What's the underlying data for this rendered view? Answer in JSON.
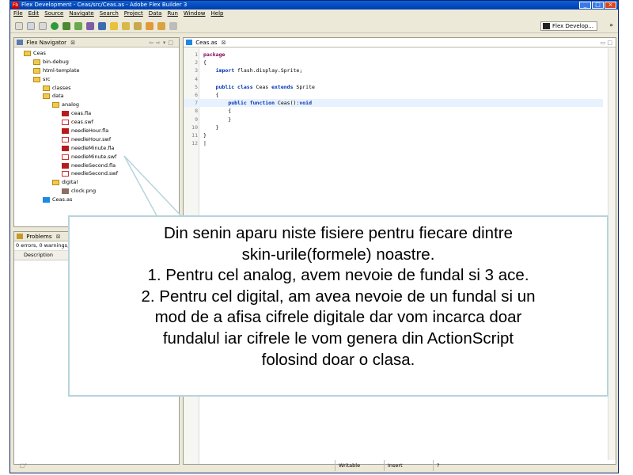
{
  "window": {
    "title": "Flex Development - Ceas/src/Ceas.as - Adobe Flex Builder 3",
    "app_icon": "Fb",
    "controls": [
      "minimize",
      "maximize",
      "close"
    ]
  },
  "menu": [
    "File",
    "Edit",
    "Source",
    "Navigate",
    "Search",
    "Project",
    "Data",
    "Run",
    "Window",
    "Help"
  ],
  "toolbar": {
    "perspective": "Flex Develop...",
    "overflow": "»"
  },
  "navigator": {
    "tab": "Flex Navigator",
    "tree": [
      {
        "label": "Ceas",
        "icon": "project-icon",
        "depth": 0
      },
      {
        "label": "bin-debug",
        "icon": "folder-icon",
        "depth": 1
      },
      {
        "label": "html-template",
        "icon": "folder-icon",
        "depth": 1
      },
      {
        "label": "src",
        "icon": "folder-icon",
        "depth": 1
      },
      {
        "label": "classes",
        "icon": "folder-icon",
        "depth": 2
      },
      {
        "label": "data",
        "icon": "folder-icon",
        "depth": 2
      },
      {
        "label": "analog",
        "icon": "folder-icon",
        "depth": 3
      },
      {
        "label": "ceas.fla",
        "icon": "fla-file-icon",
        "depth": 4
      },
      {
        "label": "ceas.swf",
        "icon": "swf-file-icon",
        "depth": 4
      },
      {
        "label": "needleHour.fla",
        "icon": "fla-file-icon",
        "depth": 4
      },
      {
        "label": "needleHour.swf",
        "icon": "swf-file-icon",
        "depth": 4
      },
      {
        "label": "needleMinute.fla",
        "icon": "fla-file-icon",
        "depth": 4
      },
      {
        "label": "needleMinute.swf",
        "icon": "swf-file-icon",
        "depth": 4
      },
      {
        "label": "needleSecond.fla",
        "icon": "fla-file-icon",
        "depth": 4
      },
      {
        "label": "needleSecond.swf",
        "icon": "swf-file-icon",
        "depth": 4
      },
      {
        "label": "digital",
        "icon": "folder-icon",
        "depth": 3
      },
      {
        "label": "clock.png",
        "icon": "image-file-icon",
        "depth": 4
      },
      {
        "label": "Ceas.as",
        "icon": "as-file-icon",
        "depth": 2
      }
    ]
  },
  "problems": {
    "tab": "Problems",
    "summary": "0 errors, 0 warnings, 0",
    "column": "Description"
  },
  "editor": {
    "tab": "Ceas.as",
    "lines": [
      {
        "n": "1",
        "parts": [
          {
            "t": "package",
            "c": "kw"
          }
        ]
      },
      {
        "n": "2",
        "parts": [
          {
            "t": "{",
            "c": ""
          }
        ]
      },
      {
        "n": "3",
        "parts": [
          {
            "t": "    ",
            "c": ""
          },
          {
            "t": "import",
            "c": "kw2"
          },
          {
            "t": " flash.display.Sprite;",
            "c": ""
          }
        ]
      },
      {
        "n": "4",
        "parts": []
      },
      {
        "n": "5",
        "parts": [
          {
            "t": "    ",
            "c": ""
          },
          {
            "t": "public class",
            "c": "kw2"
          },
          {
            "t": " Ceas ",
            "c": ""
          },
          {
            "t": "extends",
            "c": "kw2"
          },
          {
            "t": " Sprite",
            "c": ""
          }
        ]
      },
      {
        "n": "6",
        "parts": [
          {
            "t": "    {",
            "c": ""
          }
        ]
      },
      {
        "n": "7",
        "parts": [
          {
            "t": "        ",
            "c": ""
          },
          {
            "t": "public function",
            "c": "kw2"
          },
          {
            "t": " Ceas():",
            "c": ""
          },
          {
            "t": "void",
            "c": "kw2"
          }
        ]
      },
      {
        "n": "8",
        "parts": [
          {
            "t": "        {",
            "c": ""
          }
        ]
      },
      {
        "n": "9",
        "parts": [
          {
            "t": "        }",
            "c": ""
          }
        ]
      },
      {
        "n": "10",
        "parts": [
          {
            "t": "    }",
            "c": ""
          }
        ]
      },
      {
        "n": "11",
        "parts": [
          {
            "t": "}",
            "c": ""
          }
        ]
      },
      {
        "n": "12",
        "parts": [
          {
            "t": "|",
            "c": ""
          }
        ]
      }
    ]
  },
  "statusbar": {
    "mode": "Writable",
    "insert": "Insert",
    "position": "?"
  },
  "callout": {
    "lines": [
      "Din senin aparu niste fisiere pentru fiecare dintre",
      "skin-urile(formele) noastre.",
      "1. Pentru cel analog, avem nevoie de fundal si 3 ace.",
      "2. Pentru cel digital, am avea nevoie de un fundal si un",
      "mod de a afisa cifrele digitale dar vom incarca doar",
      "fundalul iar cifrele le vom genera din ActionScript",
      "folosind doar o clasa."
    ]
  },
  "colors": {
    "titlebar": "#0a5fd8",
    "keyword": "#7f0055",
    "keyword2": "#0033b3",
    "callout_border": "#b7d4dc"
  }
}
